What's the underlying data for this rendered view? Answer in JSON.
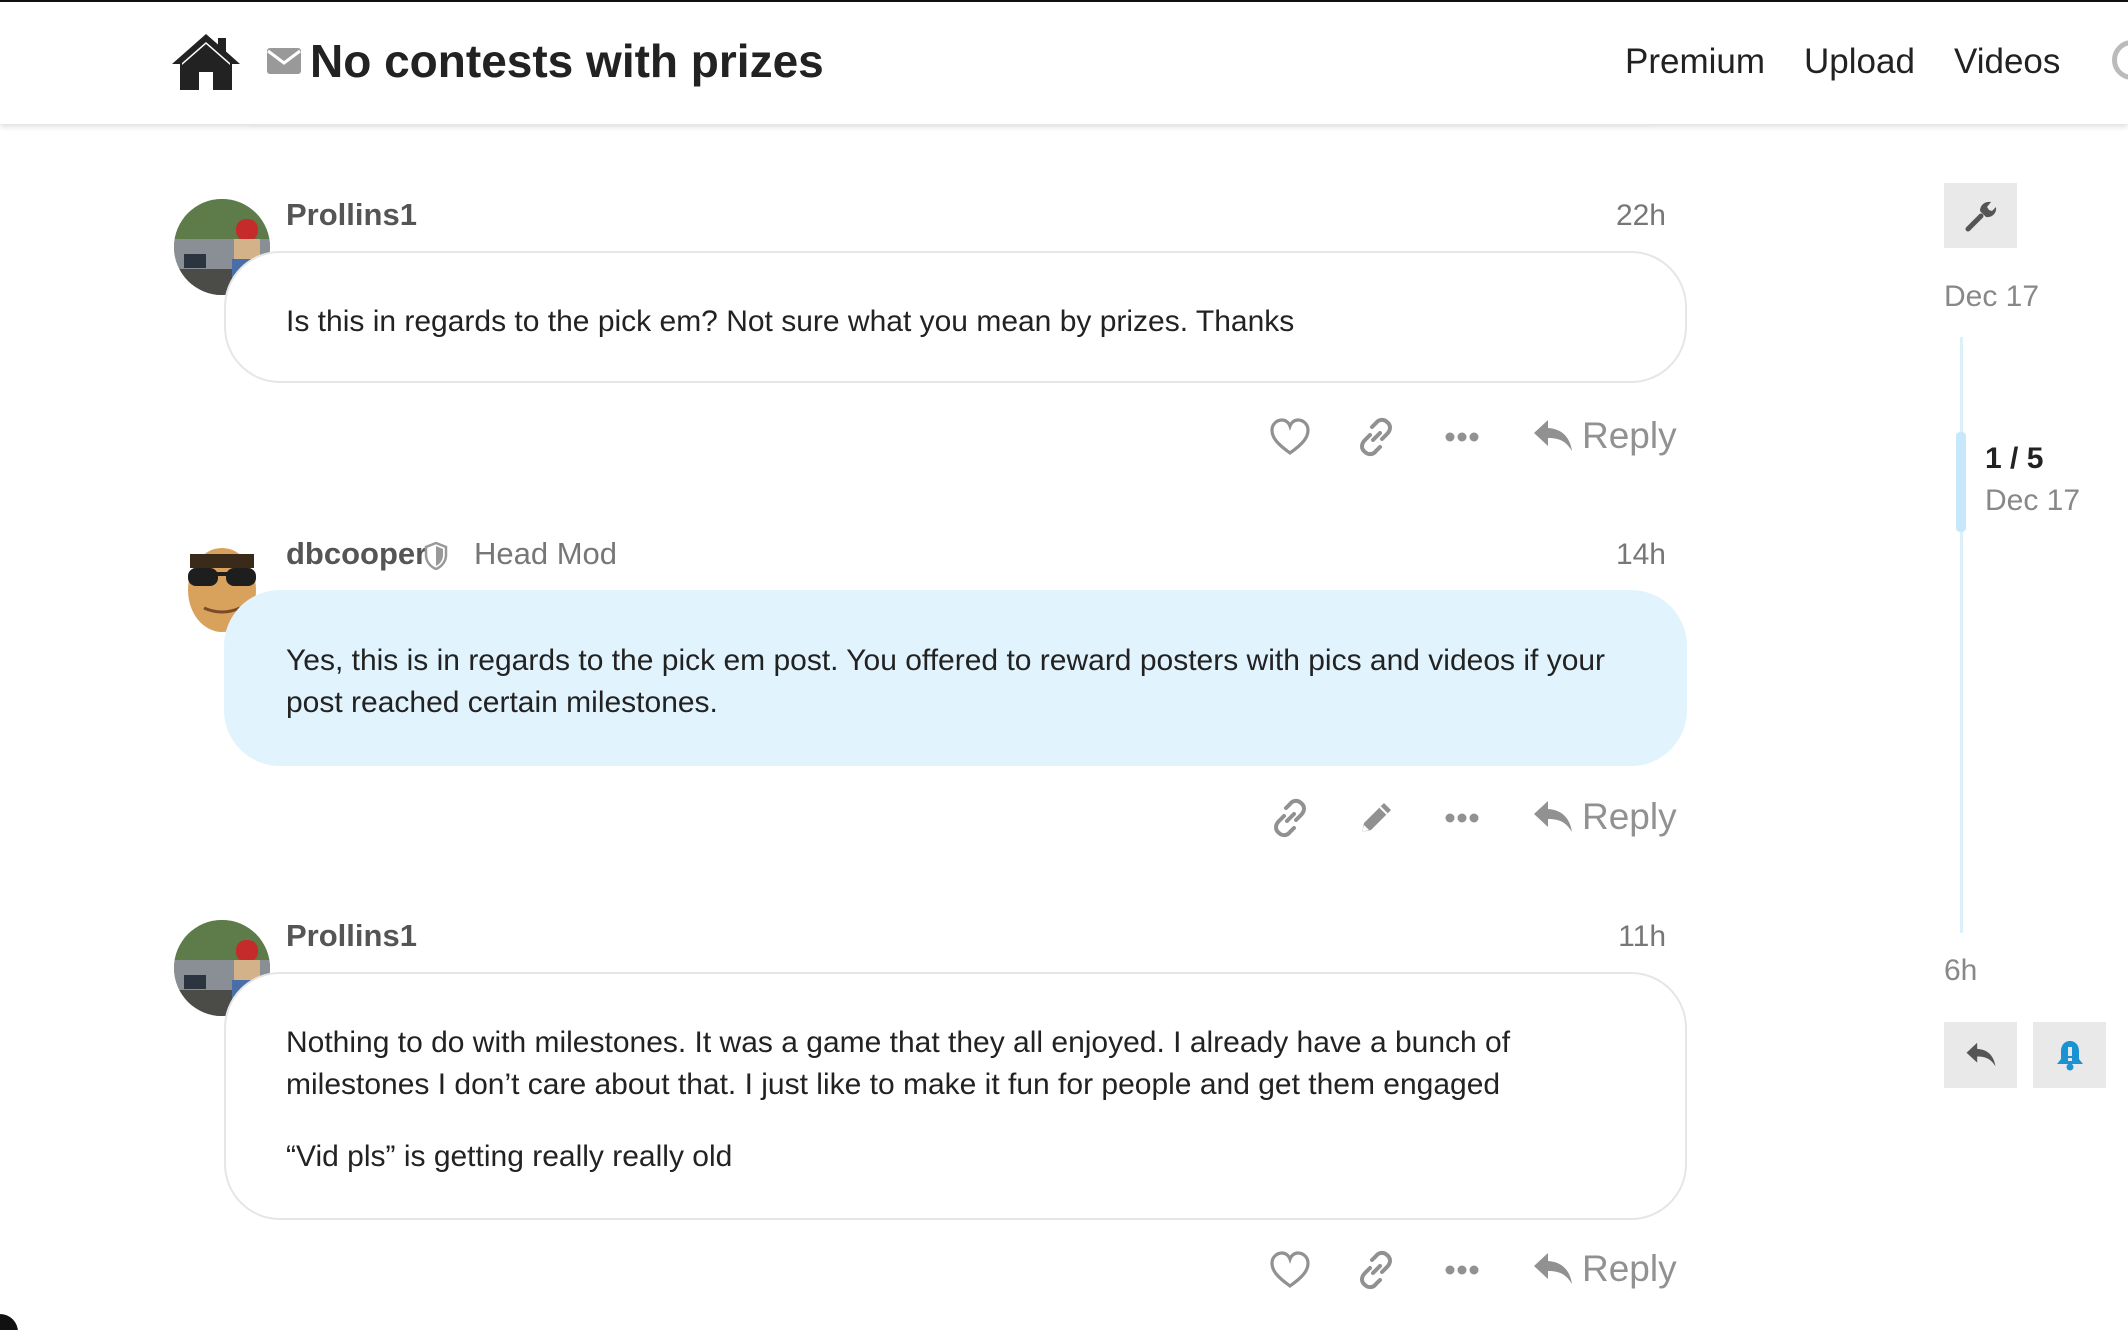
{
  "header": {
    "title": "No contests with prizes",
    "nav": [
      "Premium",
      "Upload",
      "Videos"
    ],
    "icons": {
      "home": "home-icon",
      "mail": "envelope-icon",
      "search": "search-icon"
    }
  },
  "posts": [
    {
      "username": "Prollins1",
      "user_title": "",
      "age": "22h",
      "paragraphs": [
        "Is this in regards to the pick em? Not sure what you mean by prizes. Thanks"
      ],
      "actions": [
        "like-icon",
        "link-icon",
        "more-icon"
      ],
      "reply_label": "Reply"
    },
    {
      "username": "dbcooper",
      "user_title": "Head Mod",
      "age": "14h",
      "paragraphs": [
        "Yes, this is in regards to the pick em post. You offered to reward posters with pics and videos if your post reached certain milestones."
      ],
      "actions": [
        "link-icon",
        "edit-icon",
        "more-icon"
      ],
      "reply_label": "Reply"
    },
    {
      "username": "Prollins1",
      "user_title": "",
      "age": "11h",
      "paragraphs": [
        "Nothing to do with milestones. It was a game that they all enjoyed. I already have a bunch of milestones I don’t care about that. I just like to make it fun for people and get them engaged",
        "“Vid pls” is getting really really old"
      ],
      "actions": [
        "like-icon",
        "link-icon",
        "more-icon"
      ],
      "reply_label": "Reply"
    }
  ],
  "timeline": {
    "start_date": "Dec 17",
    "position": "1 / 5",
    "position_date": "Dec 17",
    "end_age": "6h"
  },
  "colors": {
    "mod_bubble": "#e1f3fd",
    "timeline_track": "#daf0fb",
    "bell": "#1b93d3",
    "icon_gray": "#919191"
  }
}
